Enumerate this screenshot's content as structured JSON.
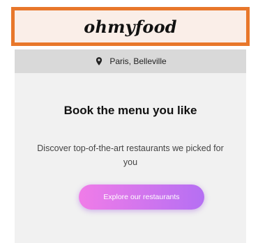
{
  "header": {
    "logo_text": "ohmyfood"
  },
  "location": {
    "icon": "location-pin-icon",
    "text": "Paris, Belleville"
  },
  "hero": {
    "title": "Book the menu you like",
    "subtitle": "Discover top-of-the-art restaurants we picked for you",
    "cta_label": "Explore our restaurants"
  },
  "colors": {
    "header_border": "#e8772b",
    "header_bg": "#faeee8",
    "location_bg": "#d9d9d9",
    "hero_bg": "#f1f1f1",
    "cta_gradient_start": "#f07ce8",
    "cta_gradient_end": "#b56ff3"
  }
}
